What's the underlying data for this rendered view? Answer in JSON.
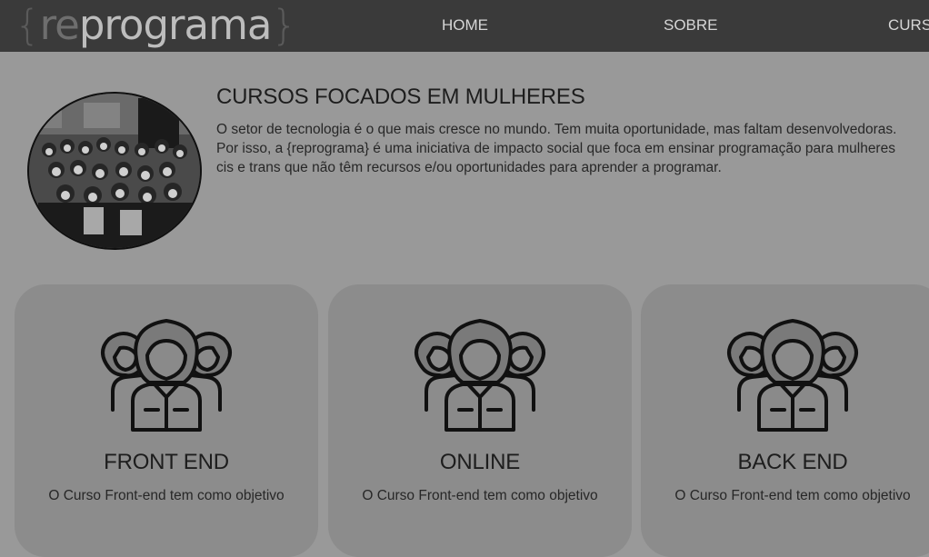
{
  "header": {
    "logo": {
      "brace_open": "{",
      "re": "re",
      "programa": "programa",
      "brace_close": "}"
    },
    "nav": [
      "HOME",
      "SOBRE",
      "CURSOS"
    ]
  },
  "intro": {
    "title": "CURSOS FOCADOS EM MULHERES",
    "lines": [
      "O setor de tecnologia é o que mais cresce no mundo. Tem muita oportunidade, mas faltam desenvolvedoras.",
      "Por isso, a {reprograma} é uma iniciativa de impacto social que foca em ensinar programação para mulheres",
      "cis e trans que não têm recursos e/ou oportunidades para aprender a programar."
    ]
  },
  "cards": [
    {
      "title": "FRONT END",
      "description": "O Curso Front-end tem como objetivo",
      "icon": "women-group-icon"
    },
    {
      "title": "ONLINE",
      "description": "O Curso Front-end tem como objetivo",
      "icon": "women-group-icon"
    },
    {
      "title": "BACK END",
      "description": "O Curso Front-end tem como objetivo",
      "icon": "women-group-icon"
    }
  ]
}
